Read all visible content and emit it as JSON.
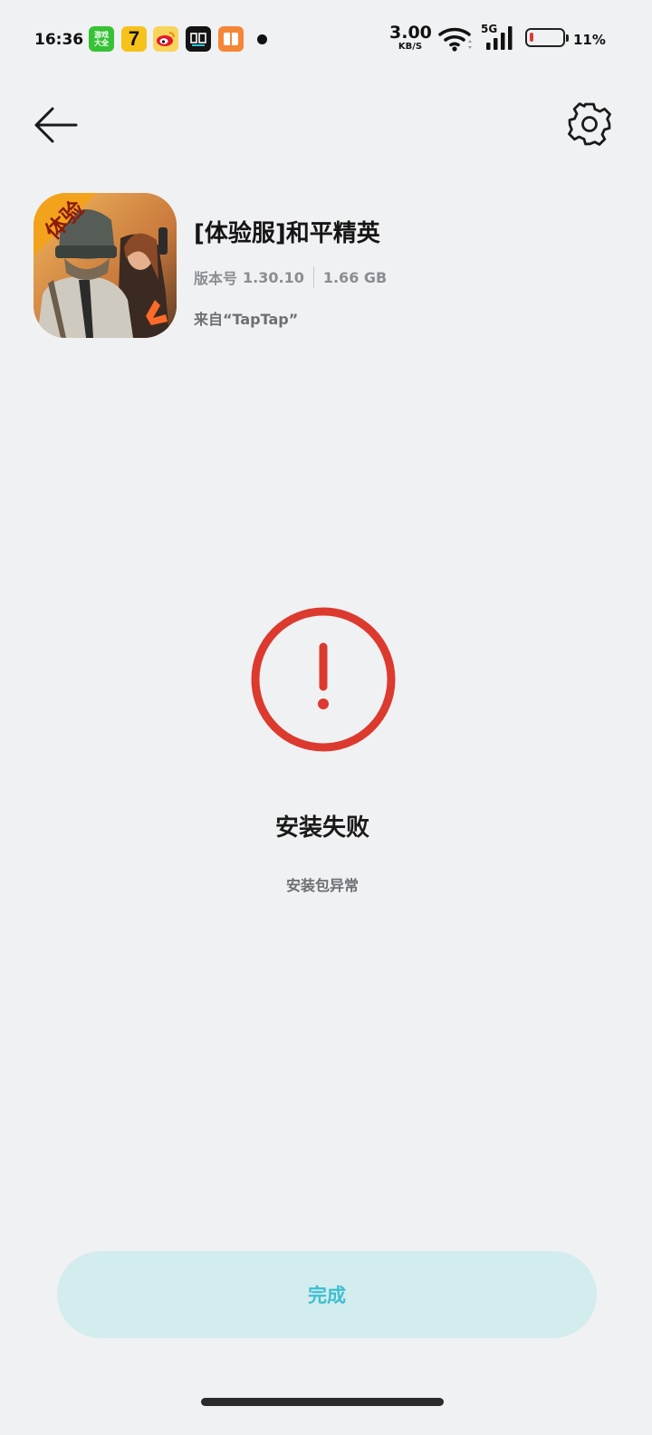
{
  "status_bar": {
    "time": "16:36",
    "net_speed_value": "3.00",
    "net_speed_unit": "KB/S",
    "network_type": "5G",
    "battery_percent": "11%",
    "battery_level": 0.11,
    "battery_color": "#e0393a",
    "notification_icons": [
      {
        "name": "game-center-app-icon",
        "text": "游戏大全"
      },
      {
        "name": "qimao-app-icon",
        "text": "7"
      },
      {
        "name": "weibo-app-icon"
      },
      {
        "name": "dewu-app-icon"
      },
      {
        "name": "reader-app-icon"
      }
    ]
  },
  "nav": {
    "back_icon": "arrow-left-icon",
    "settings_icon": "gear-icon"
  },
  "app": {
    "name": "[体验服]和平精英",
    "version_label": "版本号",
    "version": "1.30.10",
    "size": "1.66 GB",
    "source": "来自“TapTap”",
    "icon_badge": "体验"
  },
  "result": {
    "icon": "exclamation-circle-icon",
    "icon_color": "#dc3a2f",
    "title": "安装失败",
    "description": "安装包异常"
  },
  "footer": {
    "done_label": "完成",
    "button_bg": "#d3ecee",
    "button_text_color": "#3dbfd0"
  }
}
